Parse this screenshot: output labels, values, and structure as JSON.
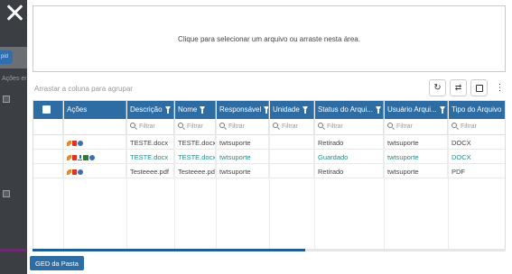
{
  "backdrop": {
    "pill_label": "pid",
    "acoes_label": "Ações en"
  },
  "upload": {
    "prompt": "Clique para selecionar um arquivo ou arraste nesta área."
  },
  "toolbar": {
    "group_hint": "Arrastar a coluna para agrupar",
    "buttons": [
      "refresh-icon",
      "swap-icon",
      "save-icon",
      "more-vertical-icon"
    ]
  },
  "grid": {
    "columns": [
      {
        "label": "Ações",
        "filter": false
      },
      {
        "label": "Descrição",
        "filter": true
      },
      {
        "label": "Nome",
        "filter": true
      },
      {
        "label": "Responsável",
        "filter": true
      },
      {
        "label": "Unidade",
        "filter": true
      },
      {
        "label": "Status do Arqui...",
        "filter": true
      },
      {
        "label": "Usuário Arqui...",
        "filter": true
      },
      {
        "label": "Tipo do Arquivo",
        "filter": false
      }
    ],
    "filter_placeholder": "Filtrar",
    "rows": [
      {
        "descricao": "TESTE.docx",
        "nome": "TESTE.docx",
        "responsavel": "twtsuporte",
        "unidade": "",
        "status": "Retirado",
        "usuario": "twtsuporte",
        "tipo": "DOCX",
        "actions": [
          "edit",
          "delete",
          "info"
        ],
        "highlight": false
      },
      {
        "descricao": "TESTE.docx",
        "nome": "TESTE.docx",
        "responsavel": "twtsuporte",
        "unidade": "",
        "status": "Guardado",
        "usuario": "twtsuporte",
        "tipo": "DOCX",
        "actions": [
          "edit",
          "delete",
          "download",
          "document",
          "info"
        ],
        "highlight": true
      },
      {
        "descricao": "Testeeee.pdf",
        "nome": "Testeeee.pdf",
        "responsavel": "twtsuporte",
        "unidade": "",
        "status": "Retirado",
        "usuario": "twtsuporte",
        "tipo": "PDF",
        "actions": [
          "edit",
          "delete",
          "info"
        ],
        "highlight": false
      }
    ]
  },
  "footer": {
    "ged_button": "GED da Pasta"
  },
  "colors": {
    "header_bg": "#2e6da4",
    "teal_text": "#1e8c8a",
    "edit_icon": "#e8892c",
    "delete_icon": "#d9342b"
  }
}
